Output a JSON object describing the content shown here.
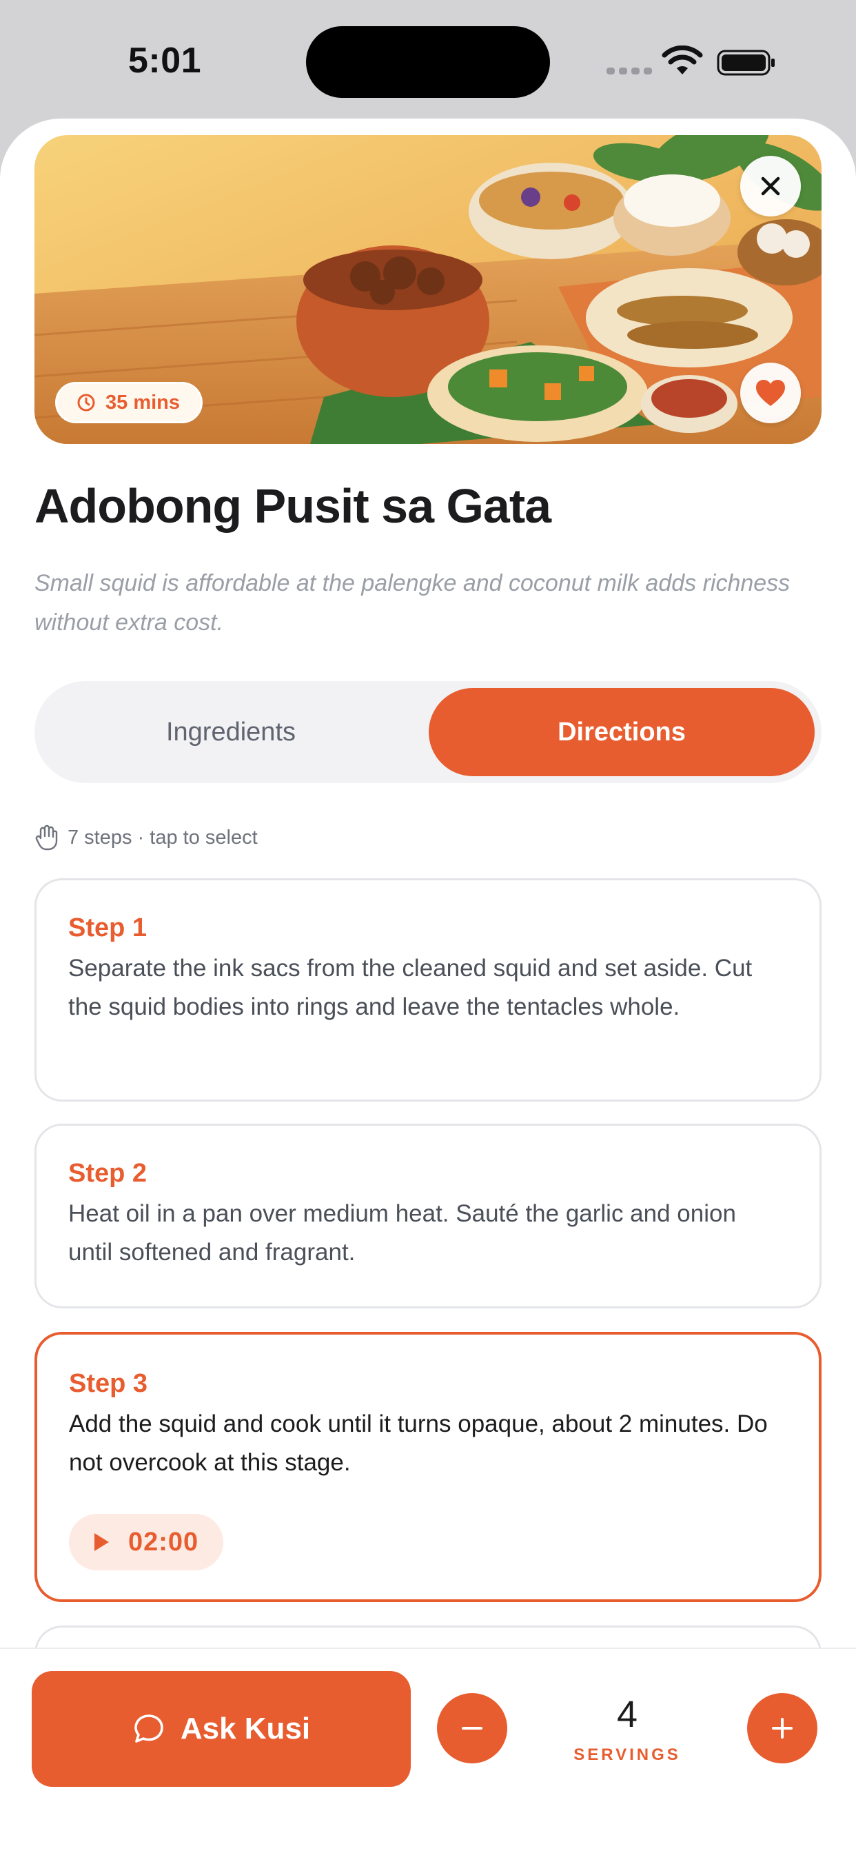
{
  "status_bar": {
    "time": "5:01"
  },
  "hero": {
    "time_badge": "35 mins",
    "close_icon": "close-icon",
    "favorite_icon": "heart-icon"
  },
  "recipe": {
    "title": "Adobong Pusit sa Gata",
    "description": "Small squid is affordable at the palengke and coconut milk adds richness without extra cost."
  },
  "tabs": [
    {
      "label": "Ingredients",
      "selected": false
    },
    {
      "label": "Directions",
      "selected": true
    }
  ],
  "steps_hint": "7 steps · tap to select",
  "steps": [
    {
      "label": "Step 1",
      "text": "Separate the ink sacs from the cleaned squid and set aside. Cut the squid bodies into rings and leave the tentacles whole."
    },
    {
      "label": "Step 2",
      "text": "Heat oil in a pan over medium heat. Sauté the garlic and onion until softened and fragrant."
    },
    {
      "label": "Step 3",
      "text": "Add the squid and cook until it turns opaque, about 2 minutes. Do not overcook at this stage.",
      "timer": "02:00",
      "selected": true
    }
  ],
  "bottom_bar": {
    "ask_label": "Ask Kusi",
    "servings": "4",
    "servings_label": "SERVINGS"
  },
  "colors": {
    "accent": "#e85d2f",
    "accent_soft": "#fdeae3",
    "segment_bg": "#f2f2f4"
  }
}
